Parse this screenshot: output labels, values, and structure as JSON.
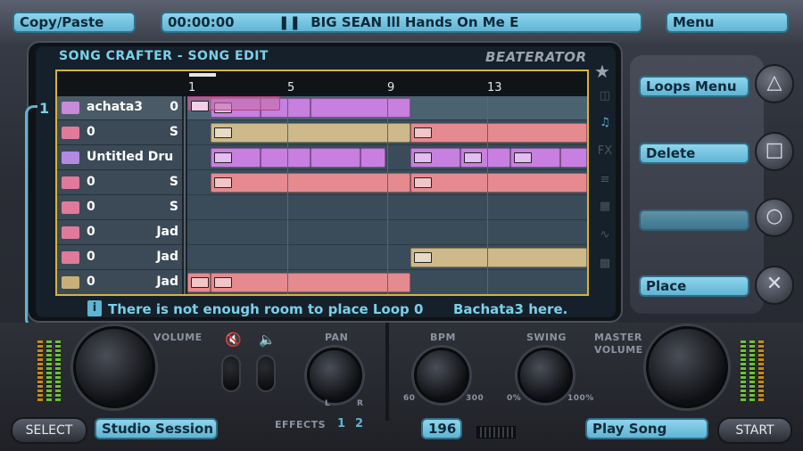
{
  "top": {
    "copy_paste": "Copy/Paste",
    "time": "00:00:00",
    "song": "BIG SEAN lll Hands On Me E",
    "menu": "Menu"
  },
  "screen": {
    "title": "SONG CRAFTER - SONG EDIT",
    "logo": "BEATERATOR",
    "group_number": "1",
    "ruler": [
      "1",
      "5",
      "9",
      "13"
    ],
    "message_left": "There is not enough room to place Loop 0",
    "message_right": "Bachata3 here."
  },
  "tracks": [
    {
      "name": "achata3",
      "value": "0",
      "color": "#c98ad8"
    },
    {
      "name": "0",
      "value": "S",
      "color": "#e07a9a"
    },
    {
      "name": "Untitled Drur",
      "value": "",
      "color": "#b38ae0"
    },
    {
      "name": "0",
      "value": "S",
      "color": "#e07a9a"
    },
    {
      "name": "0",
      "value": "S",
      "color": "#e07a9a"
    },
    {
      "name": "0",
      "value": "Jad",
      "color": "#e07a9a"
    },
    {
      "name": "0",
      "value": "Jad",
      "color": "#e07a9a"
    },
    {
      "name": "0",
      "value": "Jad",
      "color": "#c9b07a"
    }
  ],
  "right": {
    "loops_menu": "Loops Menu",
    "delete": "Delete",
    "blank": "",
    "place": "Place",
    "triangle": "△",
    "square": "□",
    "circle": "○",
    "cross": "✕"
  },
  "bottom": {
    "volume": "VOLUME",
    "pan": "PAN",
    "pan_l": "L",
    "pan_r": "R",
    "effects": "EFFECTS",
    "effects_1": "1",
    "effects_2": "2",
    "bpm": "BPM",
    "bpm_min": "60",
    "bpm_max": "300",
    "swing": "SWING",
    "swing_min": "0%",
    "swing_max": "100%",
    "master": "MASTER",
    "master2": "VOLUME",
    "select": "SELECT",
    "studio": "Studio Session",
    "bpm_value": "196",
    "play_song": "Play Song",
    "start": "START"
  },
  "colors": {
    "accent": "#7ad0ea",
    "grid_border": "#d9b23a",
    "clip_purple": "#c77fe0",
    "clip_tan": "#cdb98a",
    "clip_pink": "#e58a8f"
  }
}
